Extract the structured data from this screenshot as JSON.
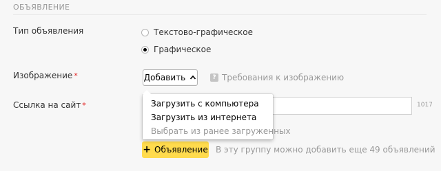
{
  "section": {
    "title": "ОБЪЯВЛЕНИЕ"
  },
  "ad_type": {
    "label": "Тип объявления",
    "options": [
      {
        "label": "Текстово-графическое",
        "selected": false
      },
      {
        "label": "Графическое",
        "selected": true
      }
    ]
  },
  "image": {
    "label": "Изображение",
    "required_mark": "*",
    "add_button_label": "Добавить",
    "requirements_link": "Требования к изображению",
    "help_icon_glyph": "?"
  },
  "site_link": {
    "label": "Ссылка на сайт",
    "required_mark": "*",
    "value": "",
    "counter": "1017"
  },
  "dropdown": {
    "items": [
      {
        "label": "Загрузить с компьютера",
        "disabled": false
      },
      {
        "label": "Загрузить из интернета",
        "disabled": false
      },
      {
        "label": "Выбрать из ранее загруженных",
        "disabled": true
      }
    ]
  },
  "footer": {
    "add_ad_button_label": "Объявление",
    "add_ad_plus": "+",
    "hint": "В эту группу можно добавить еще 49 объявлений"
  },
  "colors": {
    "accent_yellow": "#ffdb4d",
    "required_red": "#e21c1c",
    "muted_gray": "#999999"
  }
}
